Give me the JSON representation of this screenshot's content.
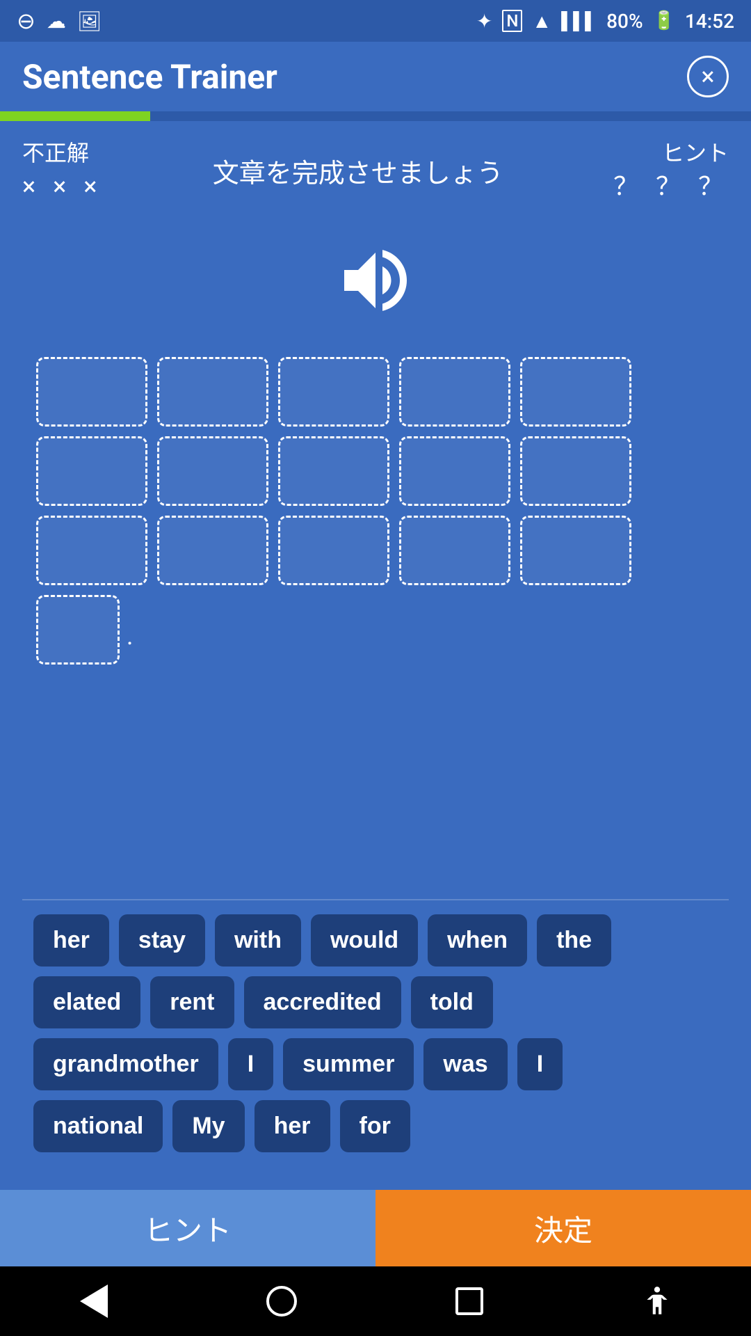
{
  "statusBar": {
    "battery": "80%",
    "time": "14:52"
  },
  "header": {
    "title": "Sentence Trainer",
    "closeLabel": "×"
  },
  "progress": {
    "percent": 20
  },
  "scoreArea": {
    "wrongLabel": "不正解",
    "wrongMarks": "× × ×",
    "instruction": "文章を完成させましょう",
    "hintLabel": "ヒント",
    "hintMarks": "？ ？ ？"
  },
  "answerSlots": {
    "rows": [
      {
        "count": 5
      },
      {
        "count": 5
      },
      {
        "count": 5
      },
      {
        "count": 1,
        "hasPeriod": true
      }
    ],
    "periodSymbol": "."
  },
  "wordChips": {
    "rows": [
      [
        "her",
        "stay",
        "with",
        "would",
        "when",
        "the"
      ],
      [
        "elated",
        "rent",
        "accredited",
        "told"
      ],
      [
        "grandmother",
        "I",
        "summer",
        "was",
        "I"
      ],
      [
        "national",
        "My",
        "her",
        "for"
      ]
    ]
  },
  "bottomButtons": {
    "hintLabel": "ヒント",
    "confirmLabel": "決定"
  }
}
